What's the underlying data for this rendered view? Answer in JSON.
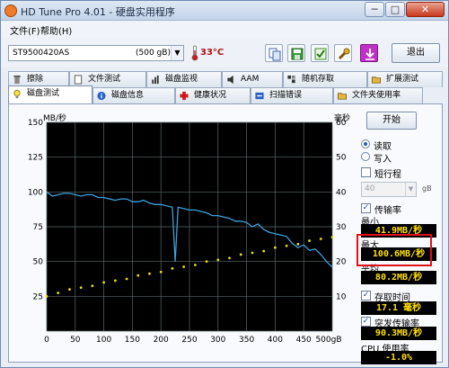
{
  "window": {
    "title": "HD Tune Pro 4.01 - 硬盘实用程序",
    "minimize": "─",
    "maximize": "□",
    "close": "✕"
  },
  "menu": {
    "file": "文件(F)",
    "help": "帮助(H)"
  },
  "toolbar": {
    "drive_name": "ST9500420AS",
    "drive_size": "(500 gB)",
    "dropdown_glyph": "▼",
    "temperature": "33°C",
    "exit_label": "退出",
    "icons": [
      "copy-icon",
      "save-icon",
      "options-icon",
      "tools-icon",
      "download-icon"
    ]
  },
  "tabs_row1": [
    {
      "label": "擦除",
      "icon": "trash-icon"
    },
    {
      "label": "文件测试",
      "icon": "file-icon"
    },
    {
      "label": "磁盘监视",
      "icon": "chart-icon"
    },
    {
      "label": "AAM",
      "icon": "speaker-icon"
    },
    {
      "label": "随机存取",
      "icon": "blocks-icon"
    },
    {
      "label": "扩展测试",
      "icon": "folder-icon"
    }
  ],
  "tabs_row2": [
    {
      "label": "磁盘测试",
      "icon": "bulb-icon",
      "active": true
    },
    {
      "label": "磁盘信息",
      "icon": "info-icon"
    },
    {
      "label": "健康状况",
      "icon": "health-icon"
    },
    {
      "label": "扫描错误",
      "icon": "scan-icon"
    },
    {
      "label": "文件夹使用率",
      "icon": "folder-icon"
    }
  ],
  "side": {
    "start_label": "开始",
    "read_label": "读取",
    "write_label": "写入",
    "short_stroke_label": "短行程",
    "block_size_value": "40",
    "block_size_unit": "gB",
    "transfer_rate_label": "传输率",
    "min_label": "最小",
    "min_value": "41.9MB/秒",
    "max_label": "最大",
    "max_value": "100.6MB/秒",
    "avg_label": "平均",
    "avg_value": "80.2MB/秒",
    "access_time_label": "存取时间",
    "access_time_value": "17.1 毫秒",
    "burst_label": "突发传输率",
    "burst_value": "90.3MB/秒",
    "cpu_label": "CPU 使用率",
    "cpu_value": "-1.0%"
  },
  "chart_data": {
    "type": "line",
    "ylabel_left": "MB/秒",
    "ylabel_right": "毫秒",
    "ylim_left": [
      0,
      150
    ],
    "ylim_right": [
      0,
      60
    ],
    "xlim": [
      0,
      500
    ],
    "x_ticks": [
      "0",
      "50",
      "100",
      "150",
      "200",
      "250",
      "300",
      "350",
      "400",
      "450",
      "500gB"
    ],
    "y_ticks_left": [
      "25",
      "50",
      "75",
      "100",
      "125",
      "150"
    ],
    "y_ticks_right": [
      "10",
      "20",
      "30",
      "40",
      "50",
      "60"
    ],
    "grid": true,
    "background": "#000000",
    "grid_color": "#5a6a6a",
    "series": [
      {
        "color": "#3ca0dc",
        "x": [
          0,
          10,
          20,
          30,
          40,
          50,
          60,
          70,
          80,
          90,
          100,
          110,
          120,
          130,
          140,
          150,
          160,
          170,
          180,
          190,
          200,
          210,
          220,
          225,
          230,
          240,
          250,
          260,
          270,
          280,
          290,
          300,
          310,
          320,
          330,
          340,
          350,
          360,
          370,
          380,
          390,
          400,
          410,
          420,
          430,
          440,
          450,
          460,
          470,
          480,
          490,
          500
        ],
        "y": [
          100,
          97,
          98,
          99,
          99,
          98,
          97,
          98,
          98,
          96,
          96,
          95,
          94,
          95,
          95,
          93,
          93,
          94,
          92,
          91,
          91,
          90,
          89,
          50,
          89,
          88,
          87,
          87,
          86,
          85,
          83,
          83,
          82,
          81,
          79,
          79,
          78,
          75,
          77,
          73,
          71,
          70,
          69,
          68,
          63,
          60,
          62,
          58,
          59,
          55,
          50,
          46
        ]
      },
      {
        "color": "#e8e000",
        "type": "scatter",
        "x": [
          0,
          20,
          40,
          60,
          80,
          100,
          120,
          140,
          160,
          180,
          200,
          220,
          240,
          260,
          280,
          300,
          320,
          340,
          360,
          380,
          400,
          420,
          440,
          460,
          480,
          500
        ],
        "y": [
          10,
          11,
          12,
          12.5,
          13,
          14,
          14.5,
          15,
          16,
          16.5,
          17,
          18,
          18.5,
          19,
          20,
          20.5,
          21,
          22,
          22.5,
          23,
          24,
          24.5,
          25,
          26,
          26.5,
          27
        ]
      }
    ]
  }
}
